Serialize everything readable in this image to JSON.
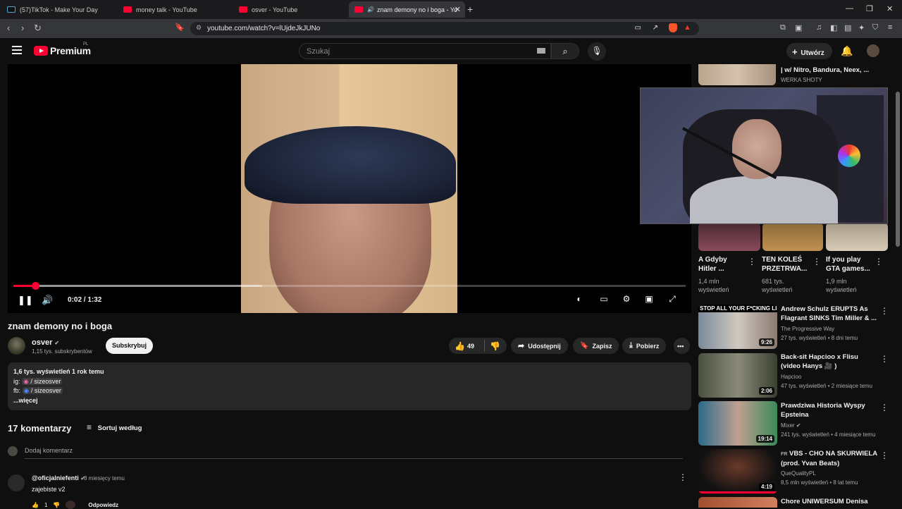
{
  "browser": {
    "tabs": [
      {
        "label": "(57)TikTok - Make Your Day",
        "favicon": "tiktok-icon"
      },
      {
        "label": "money talk - YouTube",
        "favicon": "youtube-icon"
      },
      {
        "label": "osver - YouTube",
        "favicon": "youtube-icon"
      },
      {
        "label": "znam demony no i boga - Yo",
        "favicon": "youtube-icon",
        "active": true
      }
    ],
    "url": "youtube.com/watch?v=lUjdeJkJUNo"
  },
  "header": {
    "logo_text": "Premium",
    "logo_region": "PL",
    "search_placeholder": "Szukaj",
    "create_label": "Utwórz"
  },
  "player": {
    "time": "0:02 / 1:32",
    "progress_fraction": 0.032,
    "buffered_fraction": 0.37
  },
  "video": {
    "title": "znam demony no i boga",
    "channel": "osver",
    "subscribers": "1,15 tys. subskrybentów",
    "subscribe_label": "Subskrybuj",
    "likes": "49",
    "share_label": "Udostępnij",
    "save_label": "Zapisz",
    "download_label": "Pobierz"
  },
  "description": {
    "stats": "1,6 tys. wyświetleń  1 rok temu",
    "line_ig_prefix": "ig:",
    "line_ig_tag": "/ sizeosver",
    "line_fb_prefix": "fb:",
    "line_fb_tag": "/ sizeosver",
    "more": "...więcej"
  },
  "comments": {
    "count_label": "17 komentarzy",
    "sort_label": "Sortuj według",
    "add_placeholder": "Dodaj komentarz",
    "items": [
      {
        "author": "@oficjalniefenti",
        "time": "8 miesięcy temu",
        "text": "zajebiste v2",
        "likes": "1",
        "reply_label": "Odpowiedz"
      }
    ]
  },
  "sidebar": {
    "top_item": {
      "title": "| w/ Nitro, Bandura, Neex, ...",
      "channel": "WERKA SHOTY"
    },
    "shorts": [
      {
        "title": "A Gdyby Hitler ...",
        "views": "1,4 mln wyświetleń"
      },
      {
        "title": "TEN KOLEŚ PRZETRWA...",
        "views": "681 tys. wyświetleń"
      },
      {
        "title": "If you play GTA games...",
        "views": "1,9 mln wyświetleń"
      }
    ],
    "videos": [
      {
        "title": "Andrew Schulz ERUPTS As Flagrant SINKS Tim Miller & ...",
        "channel": "The Progressive Way",
        "meta": "27 tys. wyświetleń • 8 dni temu",
        "duration": "9:26",
        "thumb_text": "STOP ALL YOUR F*CKING LIES"
      },
      {
        "title": "Back-sit Hapcioo x Flisu (video Hanys 🎥 )",
        "channel": "Hapcioo",
        "meta": "47 tys. wyświetleń • 2 miesiące temu",
        "duration": "2:06"
      },
      {
        "title": "Prawdziwa Historia Wyspy Epsteina",
        "channel": "Mixer",
        "meta": "241 tys. wyświetleń • 4 miesiące temu",
        "duration": "19:14"
      },
      {
        "title": "VBS - CHO NA SKURWIELA (prod. Yvan Beats)",
        "channel": "QueQualityPL",
        "meta": "8,5 mln wyświetleń • 8 lat temu",
        "duration": "4:19",
        "flag": "FR"
      },
      {
        "title": "Chore UNIWERSUM Denisa"
      }
    ]
  },
  "colors": {
    "accent": "#ff0033",
    "bg": "#0f0f0f",
    "surface": "#272727"
  }
}
